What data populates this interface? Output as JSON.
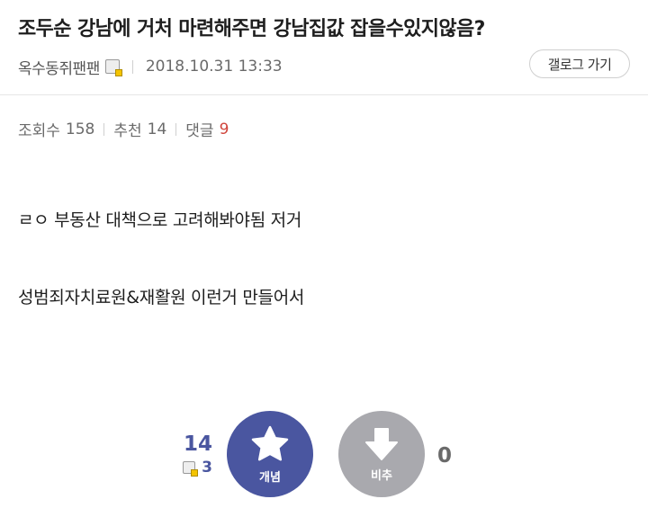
{
  "post": {
    "title": "조두순 강남에 거처 마련해주면 강남집값 잡을수있지않음?",
    "author": "옥수동쥐팬팬",
    "date": "2018.10.31 13:33",
    "back_button": "갤로그 가기"
  },
  "stats": {
    "views_label": "조회수",
    "views": "158",
    "recommend_label": "추천",
    "recommend": "14",
    "comments_label": "댓글",
    "comments": "9"
  },
  "body": {
    "lines": [
      "ㄹㅇ 부동산 대책으로 고려해봐야됨 저거",
      "성범죄자치료원&재활원 이런거 만들어서"
    ]
  },
  "votes": {
    "up_count": "14",
    "fixed_count": "3",
    "up_label": "개념",
    "down_label": "비추",
    "down_count": "0"
  },
  "colors": {
    "accent": "#4a56a0",
    "down": "#a9a9ae",
    "comment_count": "#d0453c"
  }
}
